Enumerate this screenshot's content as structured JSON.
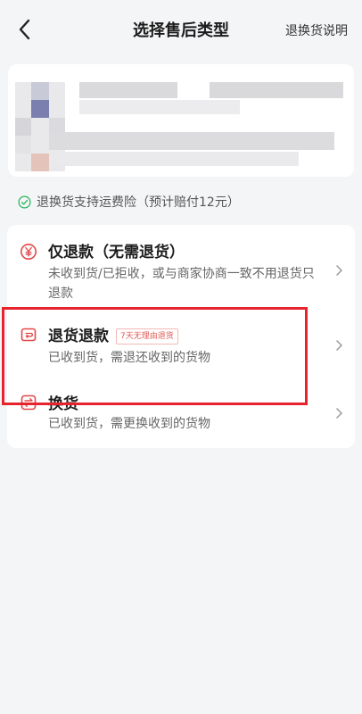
{
  "header": {
    "title": "选择售后类型",
    "help_link": "退换货说明"
  },
  "insurance_note": "退换货支持运费险（预计赔付12元）",
  "options": [
    {
      "title": "仅退款（无需退货）",
      "description": "未收到货/已拒收，或与商家协商一致不用退货只退款",
      "icon": "yen-icon"
    },
    {
      "title": "退货退款",
      "badge": "7天无理由退货",
      "description": "已收到货，需退还收到的货物",
      "icon": "return-box-icon"
    },
    {
      "title": "换货",
      "description": "已收到货，需更换收到的货物",
      "icon": "exchange-icon"
    }
  ],
  "colors": {
    "accent_red": "#e7232d",
    "icon_red": "#e2484a",
    "badge_red": "#e05a55",
    "check_green": "#25b35a"
  }
}
